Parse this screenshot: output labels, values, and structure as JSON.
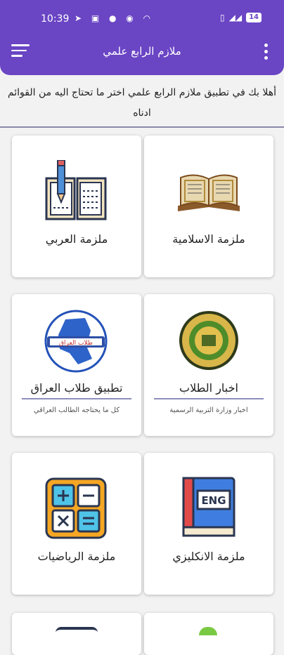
{
  "status_bar": {
    "time": "10:39",
    "battery": "14"
  },
  "app_bar": {
    "title": "ملازم الرابع علمي"
  },
  "intro_text": "أهلا بك في تطبيق ملازم الرابع علمي اختر ما تحتاج اليه من القوائم ادناه",
  "cards": [
    {
      "label": "ملزمة الاسلامية",
      "icon": "quran-book-icon"
    },
    {
      "label": "ملزمة العربي",
      "icon": "open-book-pencil-icon"
    },
    {
      "label": "اخبار الطلاب",
      "subtitle": "اخبار وزارة التربية الرسمية",
      "icon": "ministry-emblem-icon"
    },
    {
      "label": "تطبيق طلاب العراق",
      "subtitle": "كل ما يحتاجه الطالب العراقي",
      "icon": "iraq-map-logo-icon",
      "logo_text": "طلاب العراق"
    },
    {
      "label": "ملزمة الانكليزي",
      "icon": "eng-book-icon",
      "icon_text": "ENG"
    },
    {
      "label": "ملزمة الرياضيات",
      "icon": "calculator-icon"
    }
  ],
  "colors": {
    "primary": "#6a45c4",
    "background": "#f2f2f2"
  }
}
